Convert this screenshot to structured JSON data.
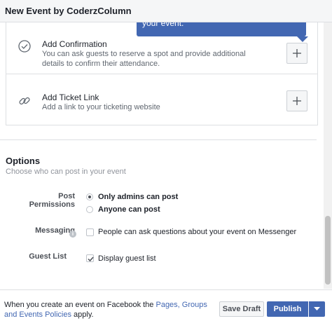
{
  "window": {
    "title": "New Event by CoderzColumn"
  },
  "tooltip": {
    "text": "your event."
  },
  "add_confirmation": {
    "title": "Add Confirmation",
    "description": "You can ask guests to reserve a spot and provide additional details to confirm their attendance."
  },
  "add_ticket_link": {
    "title": "Add Ticket Link",
    "description": "Add a link to your ticketing website"
  },
  "options": {
    "title": "Options",
    "subtitle": "Choose who can post in your event",
    "post_permissions": {
      "label": "Post Permissions",
      "choices": [
        {
          "label": "Only admins can post",
          "selected": true
        },
        {
          "label": "Anyone can post",
          "selected": false
        }
      ]
    },
    "messaging": {
      "label": "Messaging",
      "checkbox_label": "People can ask questions about your event on Messenger",
      "checked": false
    },
    "guest_list": {
      "label": "Guest List",
      "checkbox_label": "Display guest list",
      "checked": true
    }
  },
  "footer": {
    "text_before": "When you create an event on Facebook the ",
    "link": "Pages, Groups and Events Policies",
    "text_after": " apply.",
    "save_draft": "Save Draft",
    "publish": "Publish"
  },
  "colors": {
    "accent": "#4267b2",
    "border": "#dddfe2",
    "muted": "#606770"
  },
  "icons": [
    "check-circle-icon",
    "link-icon",
    "plus-icon",
    "info-icon",
    "check-icon",
    "caret-down-icon"
  ]
}
